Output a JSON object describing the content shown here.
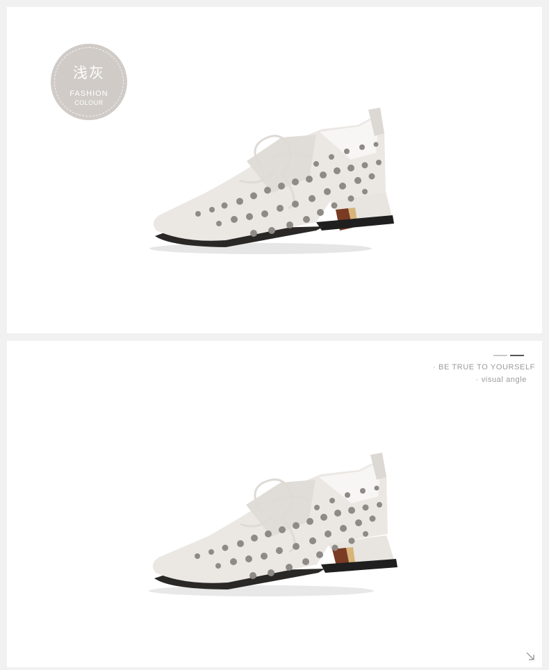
{
  "badge": {
    "title": "浅灰",
    "line1": "FASHION",
    "line2": "COLOUR",
    "color": "#d0cbc7"
  },
  "tagline": {
    "main": "· BE TRUE TO YOURSELF",
    "sub": "· visual angle"
  },
  "images": {
    "top": "shoe-side-view",
    "bottom": "shoe-side-view"
  },
  "colors": {
    "background": "#f1f1f1",
    "panel": "#ffffff",
    "leather": "#ebe8e4",
    "sole": "#1f1f1f",
    "heel_accent": "#c9a06a",
    "text": "#9a9a9a"
  },
  "icons": {
    "corner": "diagonal-arrow-icon"
  }
}
